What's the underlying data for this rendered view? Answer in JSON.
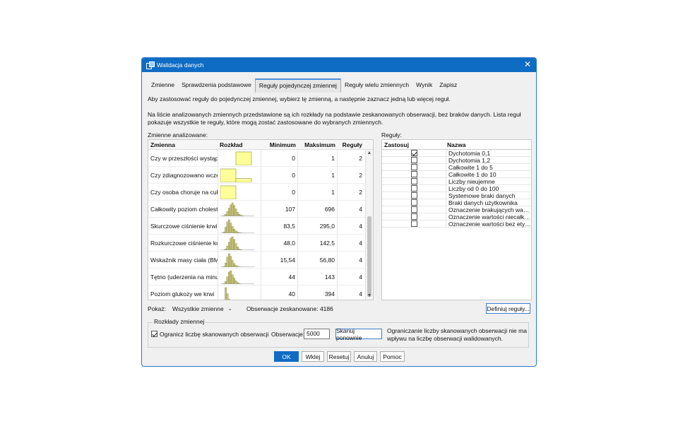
{
  "window": {
    "title": "Walidacja danych",
    "close": "✕"
  },
  "tabs": [
    {
      "label": "Zmienne"
    },
    {
      "label": "Sprawdzenia podstawowe"
    },
    {
      "label": "Reguły pojedynczej zmiennej"
    },
    {
      "label": "Reguły wielu zmiennych"
    },
    {
      "label": "Wynik"
    },
    {
      "label": "Zapisz"
    }
  ],
  "instructions": {
    "line1": "Aby zastosować reguły do pojedynczej zmiennej, wybierz tę zmienną, a następnie zaznacz jedną lub więcej reguł.",
    "line2": "Na liście analizowanych zmiennych przedstawione są ich rozkłady na podstawie zeskanowanych obserwacji, bez braków danych. Lista reguł",
    "line3": "pokazuje wszystkie te reguły, które mogą zostać zastosowane do wybranych zmiennych."
  },
  "analyzed": {
    "label": "Zmienne analizowane:",
    "columns": {
      "name": "Zmienna",
      "dist": "Rozkład",
      "min": "Minimum",
      "max": "Maksimum",
      "rules": "Reguły"
    },
    "rows": [
      {
        "name": "Czy w przeszłości wystąpił...",
        "min": "0",
        "max": "1",
        "rules": "2",
        "dist": {
          "type": "binary",
          "bars": [
            0.0,
            1.0
          ]
        }
      },
      {
        "name": "Czy zdiagnozowano wcześniej...",
        "min": "0",
        "max": "1",
        "rules": "2",
        "dist": {
          "type": "binary",
          "bars": [
            1.0,
            0.28
          ]
        }
      },
      {
        "name": "Czy osoba choruje na cukrzycę",
        "min": "0",
        "max": "1",
        "rules": "2",
        "dist": {
          "type": "binary",
          "bars": [
            1.0,
            0.0
          ]
        }
      },
      {
        "name": "Całkowity poziom cholesterolu",
        "min": "107",
        "max": "696",
        "rules": "4",
        "dist": {
          "type": "hist",
          "bars": [
            0.05,
            0.15,
            0.35,
            0.6,
            0.85,
            1.0,
            0.8,
            0.55,
            0.3,
            0.15,
            0.08,
            0.04,
            0.02,
            0.01,
            0.01
          ]
        }
      },
      {
        "name": "Skurczowe ciśnienie krwi",
        "min": "83,5",
        "max": "295,0",
        "rules": "4",
        "dist": {
          "type": "hist",
          "bars": [
            0.1,
            0.45,
            0.85,
            1.0,
            0.75,
            0.5,
            0.3,
            0.18,
            0.1,
            0.05,
            0.03,
            0.02,
            0.01
          ]
        }
      },
      {
        "name": "Rozkurczowe ciśnienie krwi",
        "min": "48,0",
        "max": "142,5",
        "rules": "4",
        "dist": {
          "type": "hist",
          "bars": [
            0.02,
            0.1,
            0.3,
            0.6,
            0.9,
            1.0,
            0.8,
            0.5,
            0.25,
            0.1,
            0.04,
            0.02
          ]
        }
      },
      {
        "name": "Wskaźnik masy ciała (BMI)",
        "min": "15,54",
        "max": "56,80",
        "rules": "4",
        "dist": {
          "type": "hist",
          "bars": [
            0.05,
            0.3,
            0.75,
            1.0,
            0.8,
            0.5,
            0.28,
            0.14,
            0.06,
            0.03,
            0.01
          ]
        }
      },
      {
        "name": "Tętno (uderzenia na minutę)",
        "min": "44",
        "max": "143",
        "rules": "4",
        "dist": {
          "type": "hist",
          "bars": [
            0.04,
            0.2,
            0.55,
            0.9,
            1.0,
            0.7,
            0.45,
            0.25,
            0.12,
            0.05,
            0.02
          ]
        }
      },
      {
        "name": "Poziom glukozy we krwi",
        "min": "40",
        "max": "394",
        "rules": "4",
        "dist": {
          "type": "hist",
          "bars": [
            0.1,
            1.0,
            0.55,
            0.15,
            0.05,
            0.03,
            0.02,
            0.01,
            0.01,
            0.01
          ]
        }
      }
    ]
  },
  "rules": {
    "label": "Reguły:",
    "columns": {
      "apply": "Zastosuj",
      "name": "Nazwa"
    },
    "items": [
      {
        "name": "Dychotomia 0,1",
        "checked": true
      },
      {
        "name": "Dychotomia 1,2",
        "checked": false
      },
      {
        "name": "Całkowite 1 do 5",
        "checked": false
      },
      {
        "name": "Całkowite 1 do 10",
        "checked": false
      },
      {
        "name": "Liczby nieujemne",
        "checked": false
      },
      {
        "name": "Liczby od 0 do 100",
        "checked": false
      },
      {
        "name": "Systemowe braki danych",
        "checked": false
      },
      {
        "name": "Braki danych użytkownika",
        "checked": false
      },
      {
        "name": "Oznaczenie brakujących wartości",
        "checked": false
      },
      {
        "name": "Oznaczenie wartości niecałkowitych",
        "checked": false
      },
      {
        "name": "Oznaczenie wartości bez etykiety",
        "checked": false
      }
    ],
    "define_button": "Definiuj reguły..."
  },
  "show": {
    "label": "Pokaż:",
    "value": "Wszystkie zmienne"
  },
  "scanned": "Obserwacje zeskanowane: 4186",
  "distributions": {
    "title": "Rozkłady zmiennej",
    "limit_checkbox": "Ogranicz liczbę skanowanych obserwacji",
    "limit_checked": true,
    "obs_label": "Obserwacje:",
    "obs_value": "5000",
    "rescan_button": "Skanuj ponownie",
    "note1": "Ograniczanie liczby skanowanych obserwacji nie ma",
    "note2": "wpływu na liczbę obserwacji walidowanych."
  },
  "buttons": {
    "ok": "OK",
    "paste": "Wklej",
    "reset": "Resetuj",
    "cancel": "Anuluj",
    "help": "Pomoc"
  },
  "colors": {
    "accent": "#0f6cc4",
    "hist_fill": "#c6c37a",
    "binary_fill": "#ffff99"
  }
}
